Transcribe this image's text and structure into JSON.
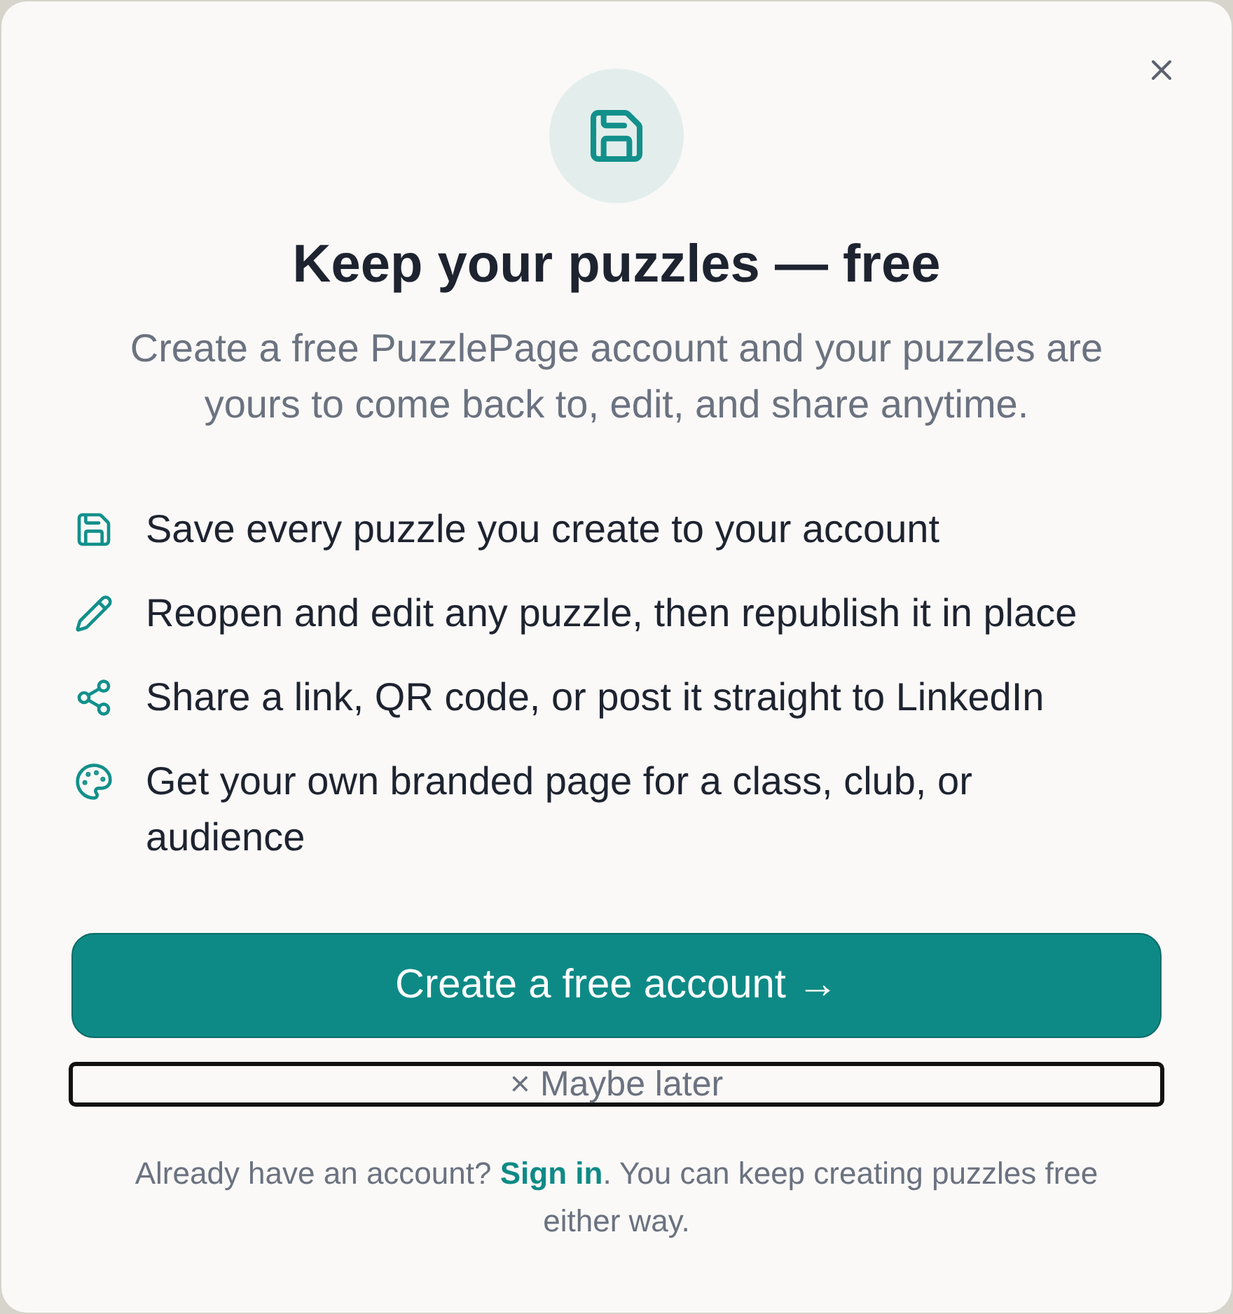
{
  "dialog": {
    "title": "Keep your puzzles — free",
    "subtitle": "Create a free PuzzlePage account and your puzzles are yours to come back to, edit, and share anytime.",
    "features": [
      {
        "kind": "save",
        "text": "Save every puzzle you create to your account"
      },
      {
        "kind": "edit",
        "text": "Reopen and edit any puzzle, then republish it in place"
      },
      {
        "kind": "share",
        "text": "Share a link, QR code, or post it straight to LinkedIn"
      },
      {
        "kind": "palette",
        "text": "Get your own branded page for a class, club, or audience"
      }
    ],
    "primary_button": "Create a free account →",
    "secondary_button": "× Maybe later",
    "footer": {
      "before": "Already have an account? ",
      "link": "Sign in",
      "after": ". You can keep creating puzzles free either way."
    }
  }
}
